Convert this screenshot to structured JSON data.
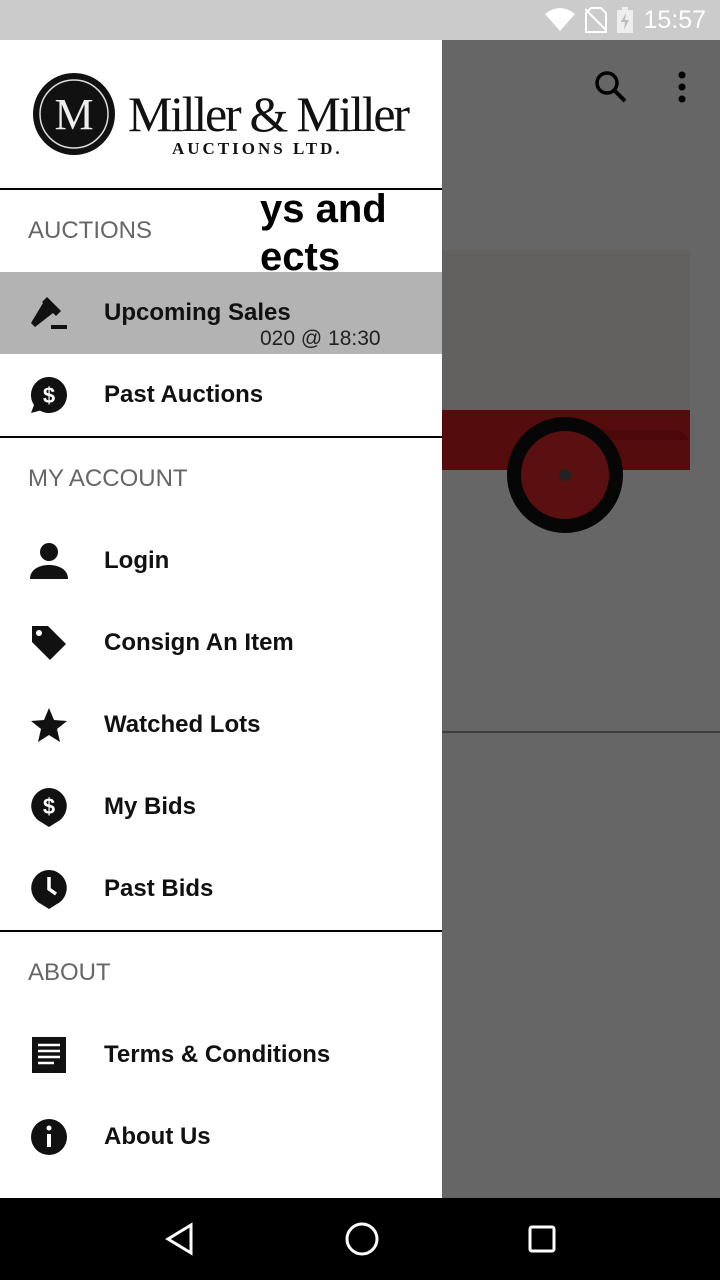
{
  "status_bar": {
    "time": "15:57",
    "icons": [
      "wifi-icon",
      "no-sim-icon",
      "battery-charging-icon"
    ]
  },
  "background": {
    "title_line1": "ys and",
    "title_line2": "ects",
    "date": "020 @ 18:30"
  },
  "drawer": {
    "logo": {
      "name": "Miller & Miller",
      "subtitle": "AUCTIONS LTD.",
      "monogram": "M"
    },
    "sections": [
      {
        "header": "AUCTIONS",
        "items": [
          {
            "label": "Upcoming Sales",
            "icon": "gavel-icon",
            "active": true
          },
          {
            "label": "Past Auctions",
            "icon": "dollar-bubble-icon"
          }
        ]
      },
      {
        "header": "MY ACCOUNT",
        "items": [
          {
            "label": "Login",
            "icon": "person-icon"
          },
          {
            "label": "Consign An Item",
            "icon": "tag-icon"
          },
          {
            "label": "Watched Lots",
            "icon": "star-icon"
          },
          {
            "label": "My Bids",
            "icon": "dollar-pin-icon"
          },
          {
            "label": "Past Bids",
            "icon": "clock-pin-icon"
          }
        ]
      },
      {
        "header": "ABOUT",
        "items": [
          {
            "label": "Terms & Conditions",
            "icon": "document-icon"
          },
          {
            "label": "About Us",
            "icon": "info-icon"
          }
        ]
      }
    ]
  },
  "navbar": [
    "back-icon",
    "home-icon",
    "recents-icon"
  ]
}
